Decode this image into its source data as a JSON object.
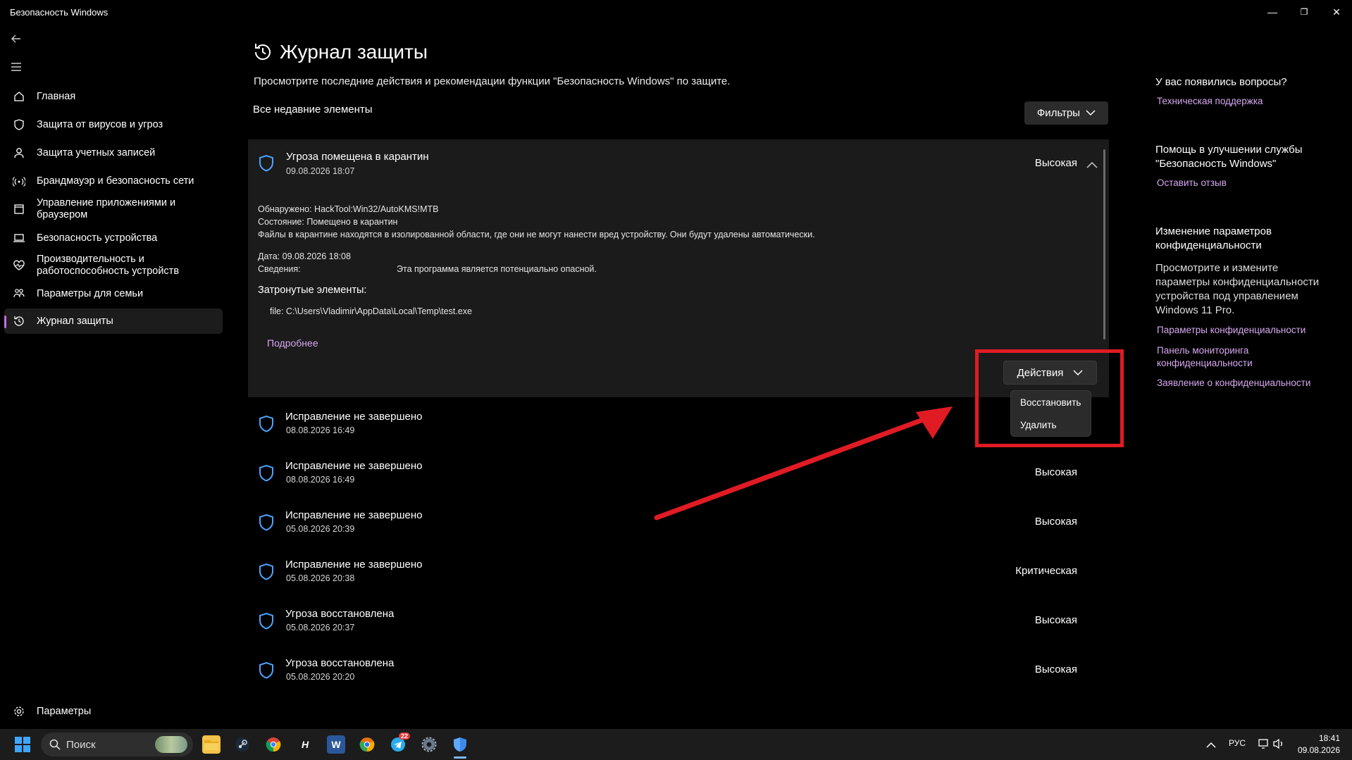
{
  "window": {
    "title": "Безопасность Windows",
    "minimize": "—",
    "restore": "❐",
    "close": "✕"
  },
  "sidebar": {
    "items": [
      {
        "label": "Главная",
        "icon": "home-icon"
      },
      {
        "label": "Защита от вирусов и угроз",
        "icon": "shield-icon"
      },
      {
        "label": "Защита учетных записей",
        "icon": "person-icon"
      },
      {
        "label": "Брандмауэр и безопасность сети",
        "icon": "wifi-icon"
      },
      {
        "label": "Управление приложениями и браузером",
        "icon": "window-icon"
      },
      {
        "label": "Безопасность устройства",
        "icon": "laptop-icon"
      },
      {
        "label": "Производительность и работоспособность устройств",
        "icon": "heart-icon"
      },
      {
        "label": "Параметры для семьи",
        "icon": "family-icon"
      },
      {
        "label": "Журнал защиты",
        "icon": "history-icon",
        "active": true
      }
    ],
    "settings_label": "Параметры"
  },
  "main": {
    "title": "Журнал защиты",
    "subtitle": "Просмотрите последние действия и рекомендации функции \"Безопасность Windows\" по защите.",
    "section_label": "Все недавние элементы",
    "filters_label": "Фильтры",
    "expanded": {
      "title": "Угроза помещена в карантин",
      "date": "09.08.2026 18:07",
      "severity": "Высокая",
      "detected": "Обнаружено: HackTool:Win32/AutoKMS!MTB",
      "state": "Состояние: Помещено в карантин",
      "note": "Файлы в карантине находятся в изолированной области, где они не могут нанести вред устройству. Они будут удалены автоматически.",
      "date_line": "Дата: 09.08.2026 18:08",
      "info_label": "Сведения:",
      "info_value": "Эта программа является потенциально опасной.",
      "affected_heading": "Затронутые элементы:",
      "affected_file": "file: C:\\Users\\Vladimir\\AppData\\Local\\Temp\\test.exe",
      "more_link": "Подробнее",
      "actions_label": "Действия",
      "menu": [
        "Восстановить",
        "Удалить"
      ]
    },
    "items": [
      {
        "title": "Исправление не завершено",
        "date": "08.08.2026 16:49",
        "severity": ""
      },
      {
        "title": "Исправление не завершено",
        "date": "08.08.2026 16:49",
        "severity": "Высокая"
      },
      {
        "title": "Исправление не завершено",
        "date": "05.08.2026 20:39",
        "severity": "Высокая"
      },
      {
        "title": "Исправление не завершено",
        "date": "05.08.2026 20:38",
        "severity": "Критическая"
      },
      {
        "title": "Угроза восстановлена",
        "date": "05.08.2026 20:37",
        "severity": "Высокая"
      },
      {
        "title": "Угроза восстановлена",
        "date": "05.08.2026 20:20",
        "severity": "Высокая"
      }
    ]
  },
  "right_panel": {
    "q_heading": "У вас появились вопросы?",
    "q_link": "Техническая поддержка",
    "improve_heading_1": "Помощь в улучшении службы",
    "improve_heading_2": "\"Безопасность Windows\"",
    "improve_link": "Оставить отзыв",
    "privacy_heading_1": "Изменение параметров",
    "privacy_heading_2": "конфиденциальности",
    "privacy_text_1": "Просмотрите и измените",
    "privacy_text_2": "параметры конфиденциальности",
    "privacy_text_3": "устройства под управлением",
    "privacy_text_4": "Windows 11 Pro.",
    "privacy_link_1": "Параметры конфиденциальности",
    "privacy_link_2a": "Панель мониторинга",
    "privacy_link_2b": "конфиденциальности",
    "privacy_link_3": "Заявление о конфиденциальности"
  },
  "taskbar": {
    "search_placeholder": "Поиск",
    "apps": [
      "file-explorer-icon",
      "steam-icon",
      "chrome-icon",
      "h-app-icon",
      "word-icon",
      "chrome-beta-icon",
      "telegram-icon",
      "settings-icon",
      "defender-icon"
    ],
    "word_glyph": "W",
    "h_glyph": "H",
    "telegram_badge": "22",
    "lang": "РУС",
    "time": "18:41",
    "date": "09.08.2026"
  },
  "accent_colors": {
    "link": "#d6a8f0",
    "shield": "#4aa3ff",
    "highlight": "#e01b24"
  }
}
